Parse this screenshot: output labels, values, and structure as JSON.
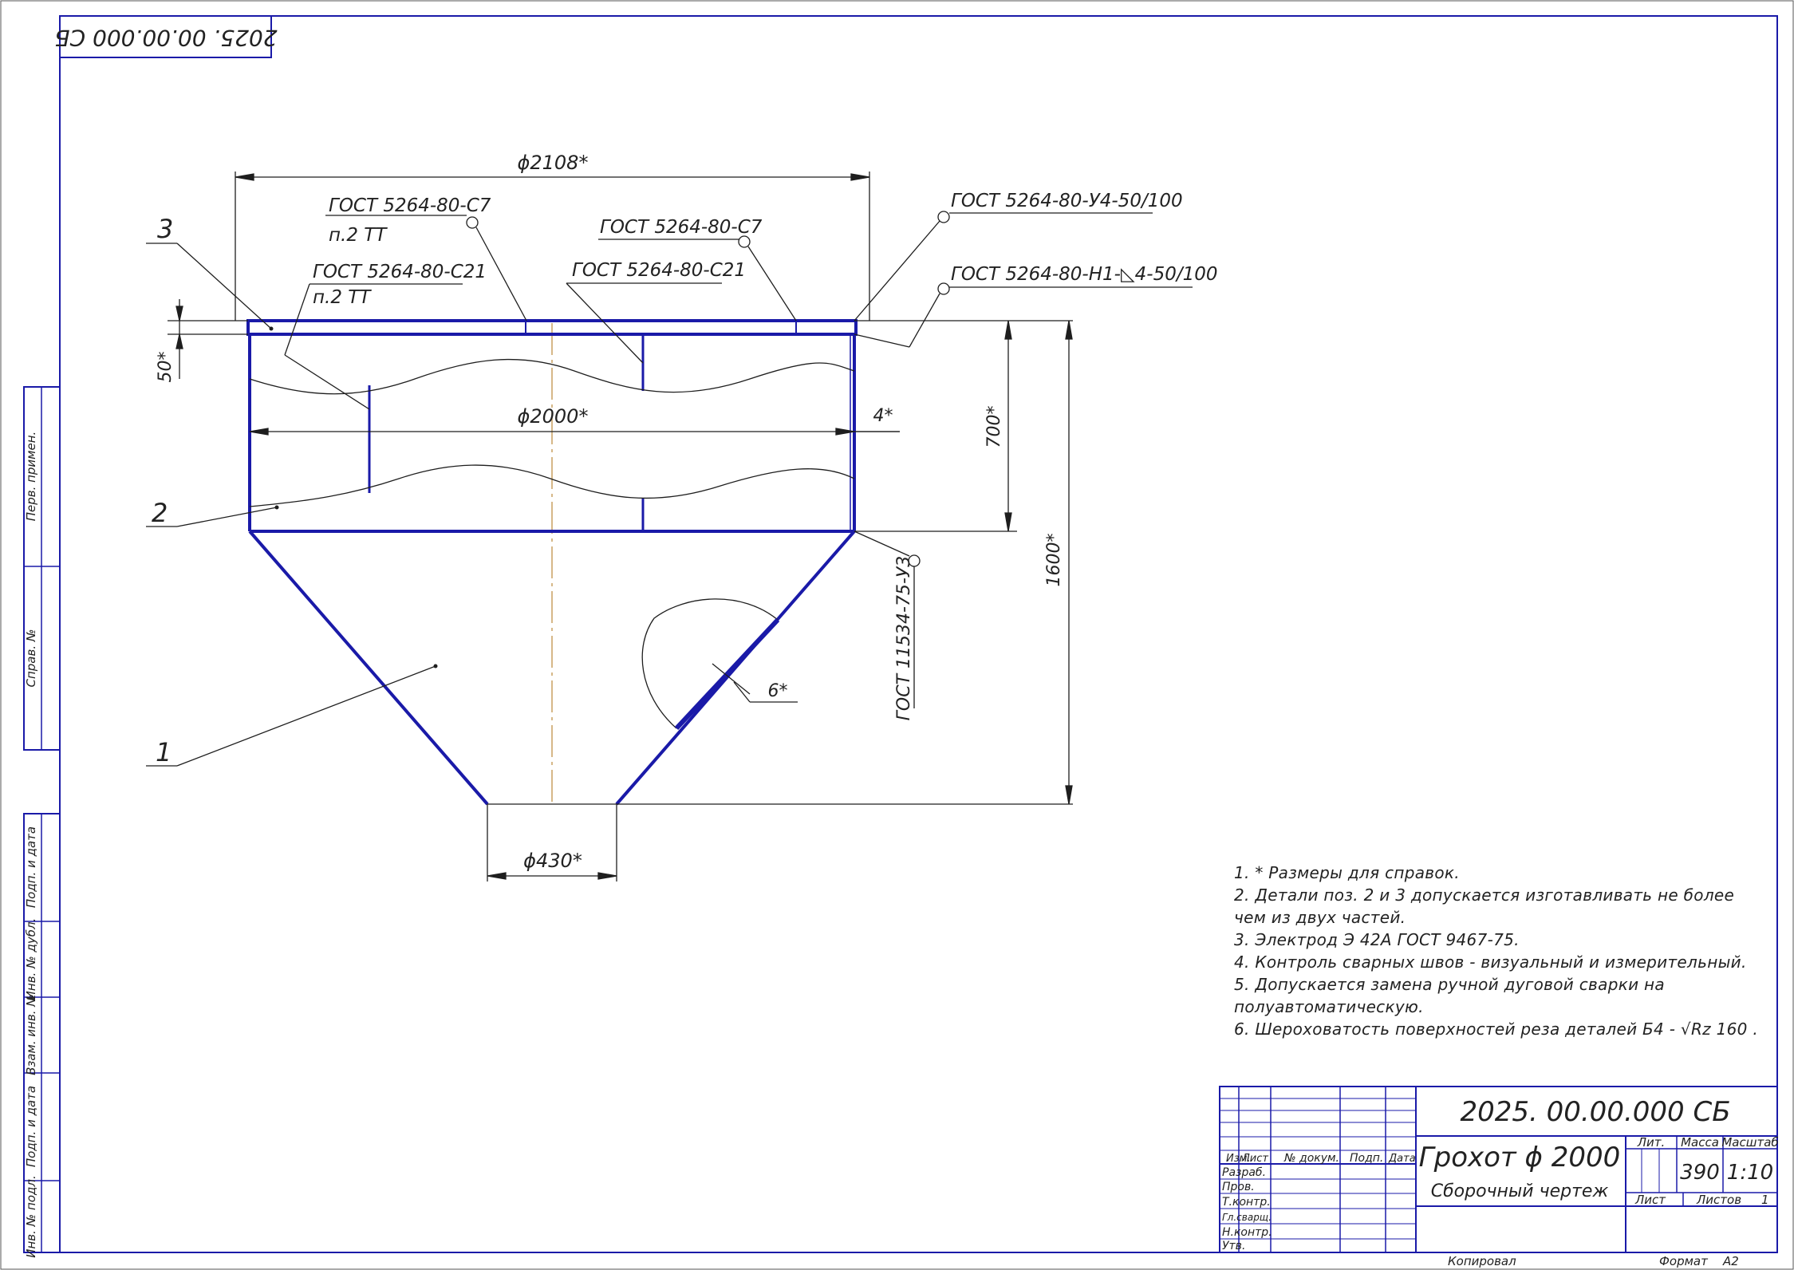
{
  "drawing": {
    "doc_number": "2025. 00.00.000 СБ",
    "doc_number_rotated": "2025. 00.00.000 СБ",
    "title": "Грохот ϕ 2000",
    "subtitle": "Сборочный чертеж",
    "mass": "390",
    "scale": "1:10",
    "sheet_label": "Лист",
    "sheets_label": "Листов",
    "sheets_count": "1",
    "lit_label": "Лит.",
    "mass_label": "Масса",
    "scale_label": "Масштаб",
    "copied_label": "Копировал",
    "format_label": "Формат",
    "format_value": "А2"
  },
  "title_block_cols": [
    "Изм.",
    "Лист",
    "№ докум.",
    "Подп.",
    "Дата"
  ],
  "title_block_rows": [
    "Разраб.",
    "Пров.",
    "Т.контр.",
    "Гл.сварщ.",
    "Н.контр.",
    "Утв."
  ],
  "side_stamps": [
    "Перв. примен.",
    "Справ. №",
    "Подп. и дата",
    "Инв. № дубл.",
    "Взам. инв. №",
    "Подп. и дата",
    "Инв. № подл."
  ],
  "dimensions": {
    "top_diameter": "ϕ2108*",
    "mid_diameter": "ϕ2000*",
    "bottom_diameter": "ϕ430*",
    "height_50": "50*",
    "height_700": "700*",
    "height_1600": "1600*",
    "thickness_4": "4*",
    "thickness_6": "6*"
  },
  "weld_callouts": {
    "c1_line1": "ГОСТ 5264-80-С7",
    "c1_line2": "п.2 ТТ",
    "c2_line1": "ГОСТ 5264-80-С21",
    "c2_line2": "п.2 ТТ",
    "c3": "ГОСТ 5264-80-С7",
    "c4": "ГОСТ 5264-80-С21",
    "c5": "ГОСТ 5264-80-У4-50/100",
    "c6": "ГОСТ 5264-80-Н1-◺4-50/100",
    "c7": "ГОСТ 11534-75-У3"
  },
  "positions": [
    "1",
    "2",
    "3"
  ],
  "notes": [
    "1. * Размеры для справок.",
    "2. Детали поз. 2 и 3 допускается изготавливать не более чем из двух частей.",
    "3. Электрод Э 42А ГОСТ 9467-75.",
    "4. Контроль сварных швов - визуальный и измерительный.",
    "5. Допускается замена ручной дуговой сварки на полуавтоматическую.",
    "6. Шероховатость поверхностей реза деталей Б4 - √Rz 160 ."
  ],
  "colors": {
    "outline": "#1a1aa8",
    "axis": "#c8a060",
    "frame": "#1a1aa8"
  }
}
